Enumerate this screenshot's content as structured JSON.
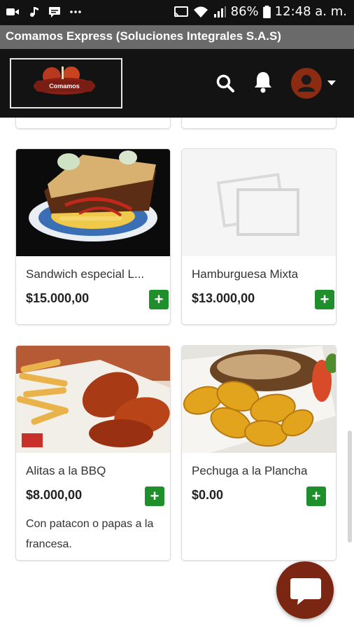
{
  "status_bar": {
    "battery": "86%",
    "time": "12:48 a. m."
  },
  "app": {
    "title": "Comamos Express (Soluciones Integrales S.A.S)",
    "logo_text": "Comamos"
  },
  "header": {
    "icons": [
      "search-icon",
      "bell-icon",
      "user-avatar-icon",
      "caret-down-icon"
    ]
  },
  "products": [
    {
      "name": "Sandwich especial L...",
      "price": "$15.000,00",
      "description": "",
      "add_label": "+",
      "image": "sandwich-photo"
    },
    {
      "name": "Hamburguesa Mixta",
      "price": "$13.000,00",
      "description": "",
      "add_label": "+",
      "image": "placeholder-image"
    },
    {
      "name": "Alitas a la BBQ",
      "price": "$8.000,00",
      "description": "Con patacon o papas a la francesa.",
      "add_label": "+",
      "image": "wings-photo"
    },
    {
      "name": "Pechuga a la Plancha",
      "price": "$0.00",
      "description": "",
      "add_label": "+",
      "image": "chicken-plantain-photo"
    }
  ],
  "colors": {
    "header_bg": "#131313",
    "title_bar_bg": "#6a6a6a",
    "add_button": "#1e8f2a",
    "chat_fab": "#7b2612",
    "avatar_bg": "#8b2b12"
  }
}
